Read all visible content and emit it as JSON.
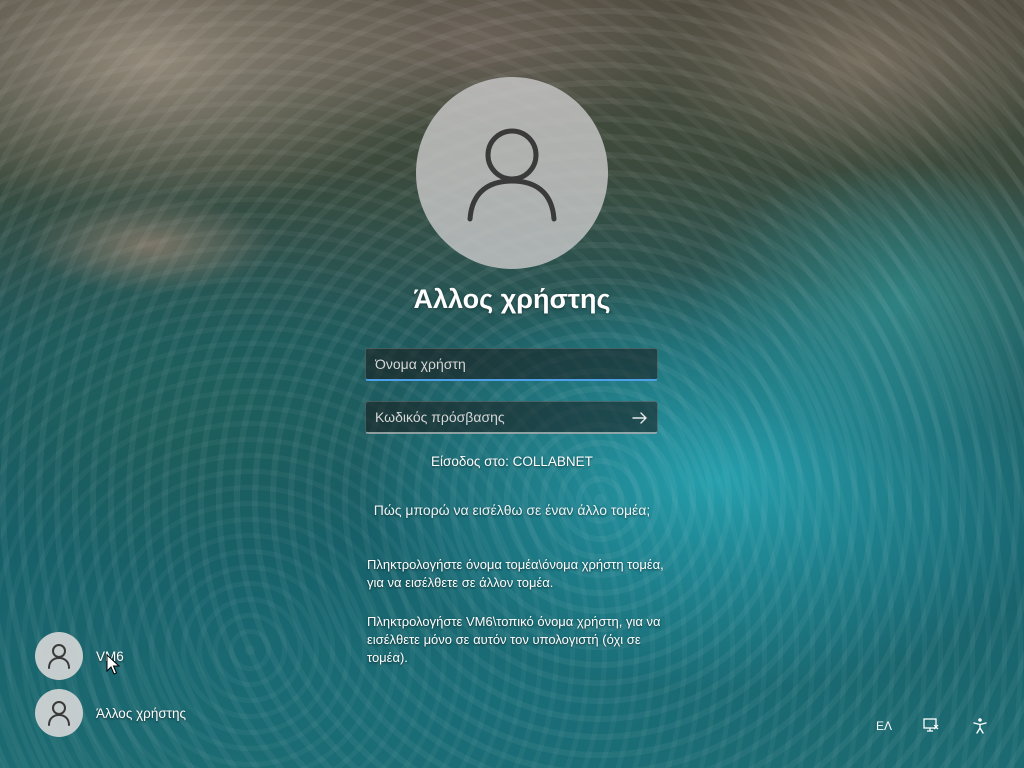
{
  "main": {
    "title": "Άλλος χρήστης",
    "username_placeholder": "Όνομα χρήστη",
    "password_placeholder": "Κωδικός πρόσβασης",
    "signin_to": "Είσοδος στο: COLLABNET",
    "help_question": "Πώς μπορώ να εισέλθω σε έναν άλλο τομέα;",
    "help_text_1": "Πληκτρολογήστε όνομα τομέα\\όνομα χρήστη τομέα, για να εισέλθετε σε άλλον τομέα.",
    "help_text_2": "Πληκτρολογήστε VM6\\τοπικό όνομα χρήστη, για να εισέλθετε μόνο σε αυτόν τον υπολογιστή (όχι σε τομέα)."
  },
  "users": [
    {
      "name": "VM6",
      "icon": "user-icon"
    },
    {
      "name": "Άλλος χρήστης",
      "icon": "user-icon"
    }
  ],
  "tray": {
    "language": "ΕΛ",
    "network_icon": "network-icon",
    "accessibility_icon": "accessibility-icon"
  },
  "colors": {
    "field_focus_accent": "#4d9fe8",
    "avatar_bg": "#c8c8c8"
  }
}
